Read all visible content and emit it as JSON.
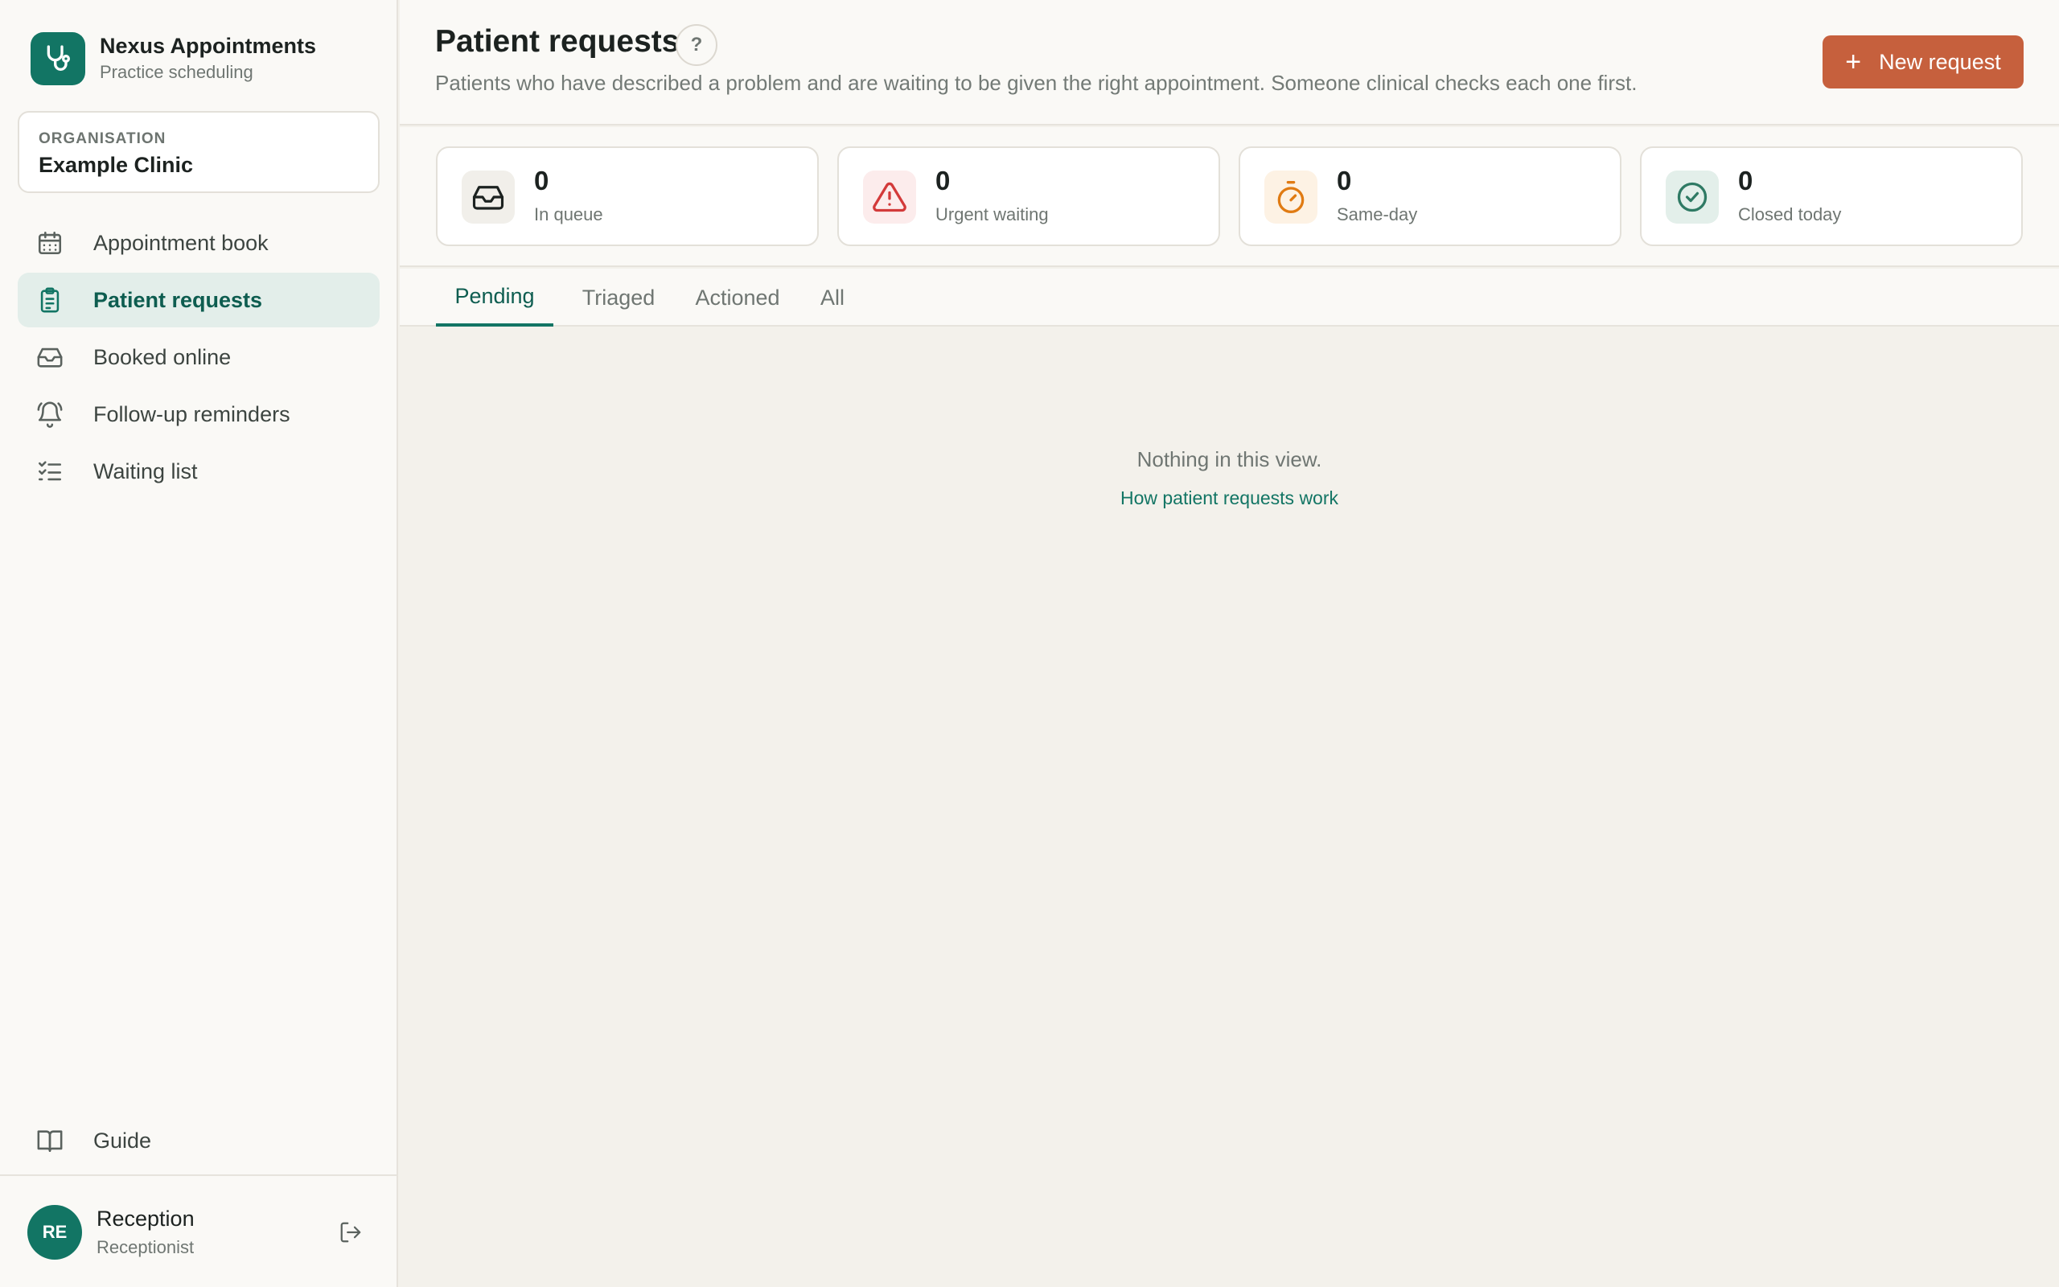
{
  "brand": {
    "name": "Nexus Appointments",
    "subtitle": "Practice scheduling",
    "icon": "stethoscope-icon",
    "color": "#127564"
  },
  "organisation": {
    "label": "ORGANISATION",
    "name": "Example Clinic"
  },
  "sidebar": {
    "items": [
      {
        "label": "Appointment book",
        "icon": "calendar-icon",
        "active": false
      },
      {
        "label": "Patient requests",
        "icon": "clipboard-icon",
        "active": true
      },
      {
        "label": "Booked online",
        "icon": "inbox-icon",
        "active": false
      },
      {
        "label": "Follow-up reminders",
        "icon": "bell-icon",
        "active": false
      },
      {
        "label": "Waiting list",
        "icon": "checklist-icon",
        "active": false
      }
    ],
    "guide": {
      "label": "Guide",
      "icon": "book-icon"
    }
  },
  "user": {
    "initials": "RE",
    "name": "Reception",
    "role": "Receptionist"
  },
  "header": {
    "title": "Patient requests",
    "help_label": "?",
    "description": "Patients who have described a problem and are waiting to be given the right appointment. Someone clinical checks each one first.",
    "new_button": "New request",
    "accent": "#c6603d"
  },
  "stats": [
    {
      "value": "0",
      "label": "In queue",
      "icon": "inbox-icon"
    },
    {
      "value": "0",
      "label": "Urgent waiting",
      "icon": "warning-icon",
      "color": "#d33a3a"
    },
    {
      "value": "0",
      "label": "Same-day",
      "icon": "timer-icon",
      "color": "#e07b13"
    },
    {
      "value": "0",
      "label": "Closed today",
      "icon": "check-circle-icon",
      "color": "#2f7a64"
    }
  ],
  "tabs": [
    {
      "label": "Pending",
      "active": true
    },
    {
      "label": "Triaged",
      "active": false
    },
    {
      "label": "Actioned",
      "active": false
    },
    {
      "label": "All",
      "active": false
    }
  ],
  "empty": {
    "message": "Nothing in this view.",
    "link": "How patient requests work"
  }
}
